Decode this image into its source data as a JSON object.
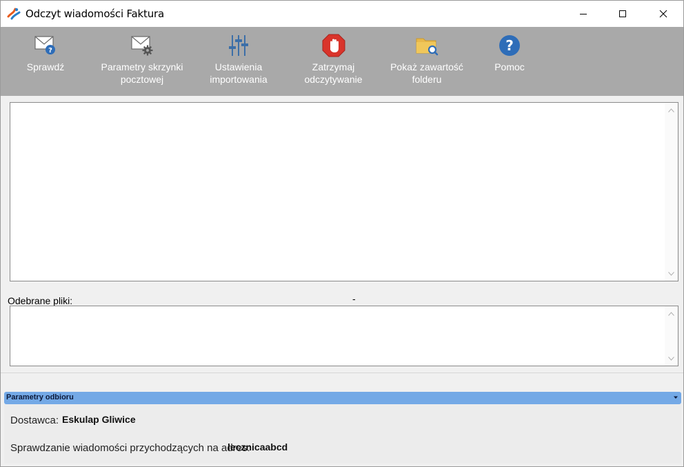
{
  "window": {
    "title": "Odczyt wiadomości Faktura"
  },
  "toolbar": {
    "items": [
      {
        "label": "Sprawdź",
        "icon": "mail-check-icon"
      },
      {
        "label": "Parametry skrzynki\npocztowej",
        "icon": "mail-settings-icon"
      },
      {
        "label": "Ustawienia\nimportowania",
        "icon": "sliders-icon"
      },
      {
        "label": "Zatrzymaj\nodczytywanie",
        "icon": "stop-hand-icon"
      },
      {
        "label": "Pokaż zawartość\nfolderu",
        "icon": "folder-search-icon"
      },
      {
        "label": "Pomoc",
        "icon": "help-icon"
      }
    ]
  },
  "received": {
    "label": "Odebrane pliki:",
    "status": "-"
  },
  "params": {
    "header": "Parametry odbioru",
    "supplier_label": "Dostawca:",
    "supplier_value": "Eskulap Gliwice",
    "address_label": "Sprawdzanie wiadomości przychodzących na adres:",
    "address_value": "lecznicaabcd"
  },
  "colors": {
    "toolbar_bg": "#a9a9a9",
    "panel_header": "#74a9e6",
    "stop_red": "#d9342b",
    "help_blue": "#2e6db8",
    "folder_yellow": "#e8b84a"
  }
}
